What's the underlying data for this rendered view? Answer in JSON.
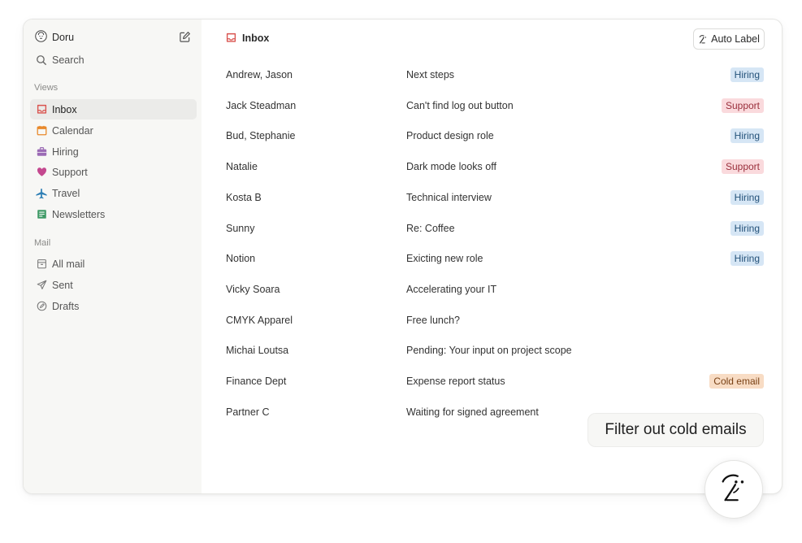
{
  "user": {
    "name": "Doru"
  },
  "search": {
    "label": "Search"
  },
  "views": {
    "title": "Views",
    "items": [
      {
        "label": "Inbox",
        "icon": "inbox-icon",
        "color": "#d9534f",
        "active": true
      },
      {
        "label": "Calendar",
        "icon": "calendar-icon",
        "color": "#e8892b"
      },
      {
        "label": "Hiring",
        "icon": "briefcase-icon",
        "color": "#9b6bb5"
      },
      {
        "label": "Support",
        "icon": "heart-icon",
        "color": "#c4488f"
      },
      {
        "label": "Travel",
        "icon": "airplane-icon",
        "color": "#2f7fb5"
      },
      {
        "label": "Newsletters",
        "icon": "newspaper-icon",
        "color": "#3f9a66"
      }
    ]
  },
  "mail": {
    "title": "Mail",
    "items": [
      {
        "label": "All mail",
        "icon": "archive-icon"
      },
      {
        "label": "Sent",
        "icon": "send-icon"
      },
      {
        "label": "Drafts",
        "icon": "draft-icon"
      }
    ]
  },
  "header": {
    "title": "Inbox",
    "auto_label": "Auto Label"
  },
  "emails": [
    {
      "sender": "Andrew, Jason",
      "subject": "Next steps",
      "label": "Hiring"
    },
    {
      "sender": "Jack Steadman",
      "subject": "Can't find log out button",
      "label": "Support"
    },
    {
      "sender": "Bud, Stephanie",
      "subject": "Product design role",
      "label": "Hiring"
    },
    {
      "sender": "Natalie",
      "subject": "Dark mode looks off",
      "label": "Support"
    },
    {
      "sender": "Kosta B",
      "subject": "Technical interview",
      "label": "Hiring"
    },
    {
      "sender": "Sunny",
      "subject": "Re: Coffee",
      "label": "Hiring"
    },
    {
      "sender": "Notion",
      "subject": "Exicting new role",
      "label": "Hiring"
    },
    {
      "sender": "Vicky Soara",
      "subject": "Accelerating your IT",
      "label": ""
    },
    {
      "sender": "CMYK Apparel",
      "subject": "Free lunch?",
      "label": ""
    },
    {
      "sender": "Michai Loutsa",
      "subject": "Pending: Your input on project scope",
      "label": ""
    },
    {
      "sender": "Finance Dept",
      "subject": "Expense report status",
      "label": "Cold email"
    },
    {
      "sender": "Partner C",
      "subject": "Waiting for signed agreement",
      "label": ""
    }
  ],
  "label_colors": {
    "Hiring": {
      "bg": "#d6e6f5",
      "fg": "#24527a"
    },
    "Support": {
      "bg": "#fadadd",
      "fg": "#9a2f3c"
    },
    "Cold email": {
      "bg": "#f8dcc4",
      "fg": "#7a4216"
    }
  },
  "toast": {
    "text": "Filter out cold emails"
  },
  "fab": {
    "icon": "ai-assistant-icon"
  }
}
